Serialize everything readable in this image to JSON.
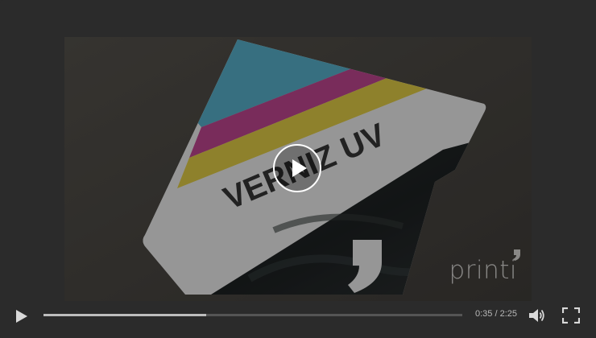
{
  "video": {
    "card_text": "VERNIZ UV",
    "watermark": "printi"
  },
  "playback": {
    "current_time": "0:35",
    "separator": "/",
    "duration": "2:25",
    "progress": 0.389
  },
  "icons": {
    "big_play": "play-icon",
    "play": "play-icon",
    "volume": "volume-icon",
    "fullscreen": "fullscreen-icon"
  },
  "colors": {
    "background": "#2b2b2b",
    "control_icon": "#d9d9d9",
    "progress_fill": "#bdbdbd",
    "progress_track": "#555555",
    "stripe_cyan": "#4da7c2",
    "stripe_magenta": "#b73a86",
    "stripe_yellow": "#d9c43a"
  }
}
